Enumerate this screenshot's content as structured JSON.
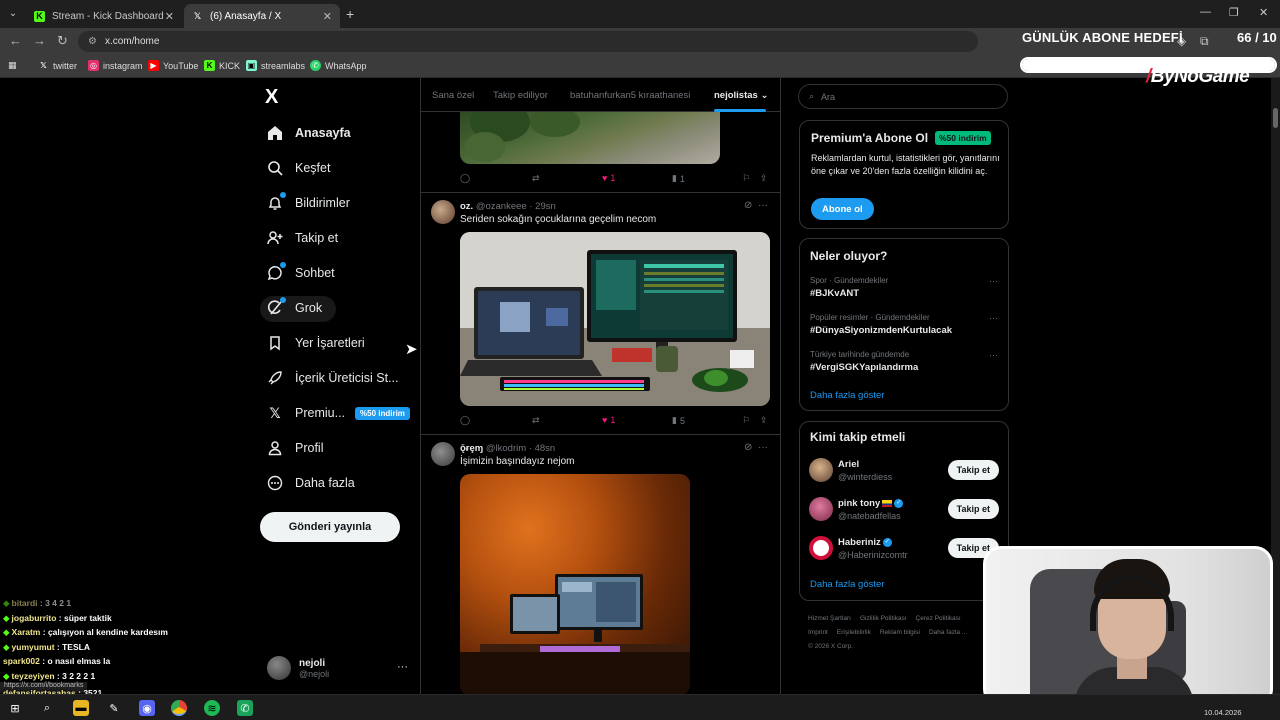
{
  "browser": {
    "tabs": [
      {
        "title": "Stream - Kick Dashboard",
        "icon": "kick-logo-icon",
        "active": false
      },
      {
        "title": "(6) Anasayfa / X",
        "icon": "x-logo-icon",
        "active": true
      }
    ],
    "url": "x.com/home",
    "bookmarks": [
      {
        "label": "twitter",
        "icon": "x-logo-icon",
        "color": "#ffffff"
      },
      {
        "label": "instagram",
        "icon": "instagram-icon",
        "color": "#e1306c"
      },
      {
        "label": "YouTube",
        "icon": "youtube-icon",
        "color": "#ff0000"
      },
      {
        "label": "KICK",
        "icon": "kick-logo-icon",
        "color": "#53fc18"
      },
      {
        "label": "streamlabs",
        "icon": "streamlabs-icon",
        "color": "#80f5d2"
      },
      {
        "label": "WhatsApp",
        "icon": "whatsapp-icon",
        "color": "#25d366"
      }
    ]
  },
  "overlay": {
    "goal_title": "GÜNLÜK ABONE HEDEFİ",
    "goal_count": "66 / 10",
    "goal_progress": 1.0,
    "brand": "ByNoGame"
  },
  "sidebar": {
    "logo": "X",
    "items": [
      {
        "label": "Anasayfa",
        "icon": "home-icon",
        "active": true
      },
      {
        "label": "Keşfet",
        "icon": "search-icon"
      },
      {
        "label": "Bildirimler",
        "icon": "bell-icon",
        "dot": true
      },
      {
        "label": "Takip et",
        "icon": "add-person-icon"
      },
      {
        "label": "Sohbet",
        "icon": "chat-icon",
        "dot": true
      },
      {
        "label": "Grok",
        "icon": "grok-icon",
        "dot": true
      },
      {
        "label": "Yer İşaretleri",
        "icon": "bookmark-icon"
      },
      {
        "label": "İçerik Üreticisi St...",
        "icon": "rocket-icon"
      },
      {
        "label": "Premiu...",
        "icon": "x-logo-icon",
        "badge": "%50 indirim"
      },
      {
        "label": "Profil",
        "icon": "person-icon"
      },
      {
        "label": "Daha fazla",
        "icon": "more-circle-icon"
      }
    ],
    "post_button": "Gönderi yayınla",
    "account": {
      "name": "nejoli",
      "handle": "@nejoli"
    }
  },
  "feed": {
    "tabs": [
      "Sana özel",
      "Takip ediliyor",
      "batuhanfurkan5 kıraathanesi",
      "nejolistas"
    ],
    "active_tab": "nejolistas",
    "tweets": [
      {
        "likes": "1",
        "views": "1"
      },
      {
        "name": "oz.",
        "handle": "@ozankeee",
        "time": "29sn",
        "text": "Seriden sokağın çocuklarına geçelim necom",
        "likes": "1",
        "views": "5"
      },
      {
        "name": "ǭɍȩɱ",
        "handle": "@lkodrim",
        "time": "48sn",
        "text": "İşimizin başındayız nejom"
      }
    ]
  },
  "right": {
    "search_placeholder": "Ara",
    "premium": {
      "title": "Premium'a Abone Ol",
      "badge": "%50 indirim",
      "desc": "Reklamlardan kurtul, istatistikleri gör, yanıtlarını öne çıkar ve 20'den fazla özelliğin kilidini aç.",
      "button": "Abone ol"
    },
    "trends": {
      "title": "Neler oluyor?",
      "items": [
        {
          "context": "Spor · Gündemdekiler",
          "tag": "#BJKvANT"
        },
        {
          "context": "Popüler resimler · Gündemdekiler",
          "tag": "#DünyaSiyonizmdenKurtulacak"
        },
        {
          "context": "Türkiye tarihinde gündemde",
          "tag": "#VergiSGKYapılandırma"
        }
      ],
      "show_more": "Daha fazla göster"
    },
    "who_to_follow": {
      "title": "Kimi takip etmeli",
      "users": [
        {
          "name": "Ariel",
          "handle": "@winterdiess",
          "button": "Takip et"
        },
        {
          "name": "pink tony",
          "handle": "@natebadfellas",
          "button": "Takip et",
          "verified": true
        },
        {
          "name": "Haberiniz",
          "handle": "@Haberinizcomtr",
          "button": "Takip et",
          "verified": true
        }
      ],
      "show_more": "Daha fazla göster"
    },
    "footer": [
      "Hizmet Şartları",
      "Gizlilik Politikası",
      "Çerez Politikası",
      "Imprint",
      "Erişilebilirlik",
      "Reklam bilgisi",
      "Daha fazla ...",
      "© 2026 X Corp."
    ]
  },
  "chat": [
    {
      "user": "bitardi",
      "msg": "3 4 2 1"
    },
    {
      "user": "jogaburrito",
      "msg": "süper taktik"
    },
    {
      "user": "Xaratm",
      "msg": "çalışıyon al kendine kardesım"
    },
    {
      "user": "yumyumut",
      "msg": "TESLA"
    },
    {
      "user": "spark002",
      "msg": "o nasıl elmas la"
    },
    {
      "user": "teyzeyiyen",
      "msg": "3 2 2 2 1"
    },
    {
      "user": "defansifortasahas",
      "msg": "3521"
    }
  ],
  "status_url": "https://x.com/i/bookmarks",
  "taskbar": {
    "date": "10.04.2026"
  }
}
